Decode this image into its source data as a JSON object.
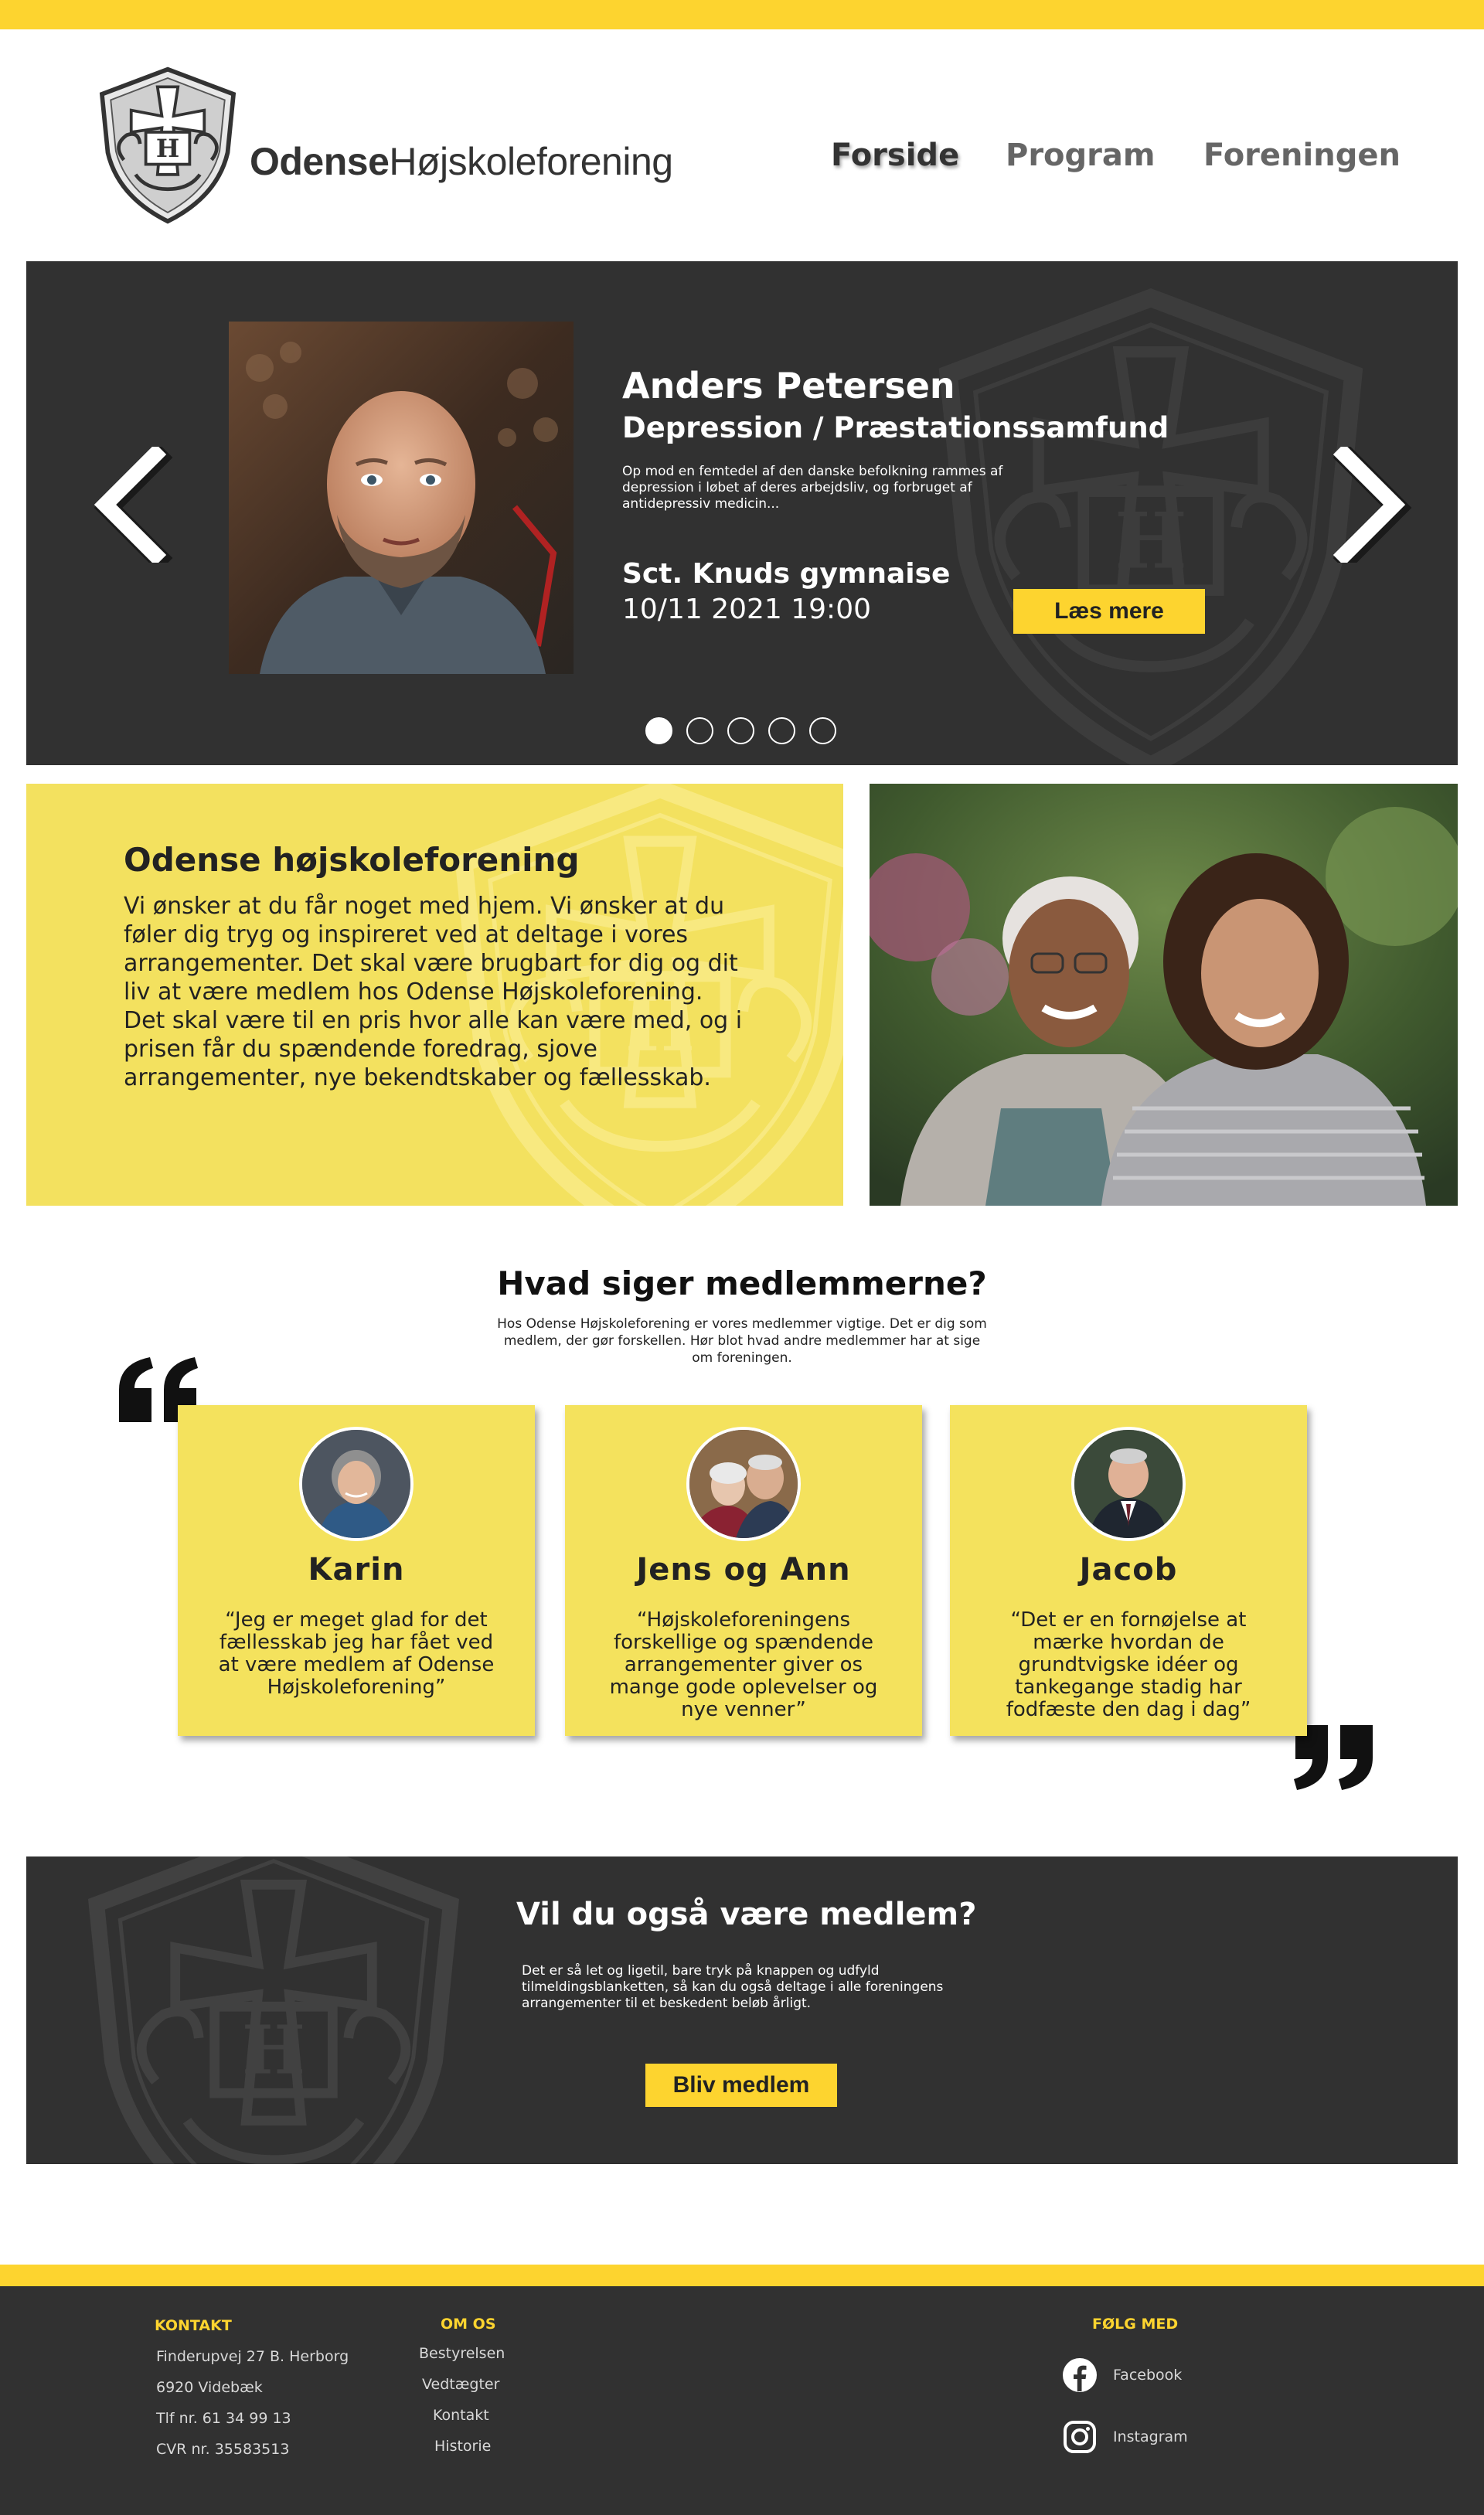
{
  "brand": {
    "name_bold": "Odense",
    "name_rest": "Højskoleforening",
    "accent": "#fdd42f",
    "dark": "#313131",
    "card_yellow": "#f4e25d"
  },
  "nav": {
    "items": [
      "Forside",
      "Program",
      "Foreningen"
    ],
    "active": "Forside"
  },
  "hero": {
    "speaker": "Anders Petersen",
    "topic": "Depression / Præstationssamfund",
    "description": "Op mod en femtedel af den danske befolkning rammes af depression i løbet af deres arbejdsliv, og forbruget af antidepressiv medicin...",
    "venue": "Sct. Knuds gymnaise",
    "datetime": "10/11 2021  19:00",
    "button": "Læs mere",
    "slides_total": 5,
    "slide_active": 1,
    "prev_icon": "chevron-left-icon",
    "next_icon": "chevron-right-icon"
  },
  "intro": {
    "title": "Odense højskoleforening",
    "body": "Vi ønsker at du får noget med hjem. Vi ønsker at du føler dig tryg og inspireret ved at deltage i vores arrangementer. Det skal være brugbart for dig og dit liv at være medlem hos Odense Højskoleforening. Det skal være til en pris hvor alle kan være med, og i prisen får du spændende foredrag, sjove arrangementer, nye bekendtskaber og fællesskab."
  },
  "testimonials": {
    "title": "Hvad siger medlemmerne?",
    "subtitle": "Hos Odense Højskoleforening er vores medlemmer vigtige. Det er dig som medlem, der gør forskellen. Hør blot hvad andre medlemmer har at sige om foreningen.",
    "items": [
      {
        "name": "Karin",
        "quote": "“Jeg er meget glad for det fællesskab jeg har fået ved at være medlem af Odense Højskoleforening”"
      },
      {
        "name": "Jens og Ann",
        "quote": "“Højskoleforeningens forskellige og spændende arrangementer giver os mange gode oplevelser og nye venner”"
      },
      {
        "name": "Jacob",
        "quote": "“Det er en fornøjelse at mærke hvordan de grundtvigske idéer og tankegange stadig har fodfæste den dag i dag”"
      }
    ]
  },
  "join": {
    "title": "Vil du også være medlem?",
    "description": "Det er så let og ligetil, bare tryk på knappen og udfyld tilmeldingsblanketten, så kan du også deltage i alle foreningens arrangementer til et beskedent beløb årligt.",
    "button": "Bliv medlem"
  },
  "footer": {
    "contact": {
      "heading": "KONTAKT",
      "lines": [
        "Finderupvej 27 B. Herborg",
        "6920 Videbæk",
        "Tlf nr. 61 34 99 13",
        "CVR nr. 35583513"
      ]
    },
    "about": {
      "heading": "OM OS",
      "links": [
        "Bestyrelsen",
        "Vedtægter",
        "Kontakt",
        "Historie"
      ]
    },
    "follow": {
      "heading": "FØLG MED",
      "links": [
        {
          "label": "Facebook",
          "icon": "facebook-icon"
        },
        {
          "label": "Instagram",
          "icon": "instagram-icon"
        }
      ]
    }
  }
}
